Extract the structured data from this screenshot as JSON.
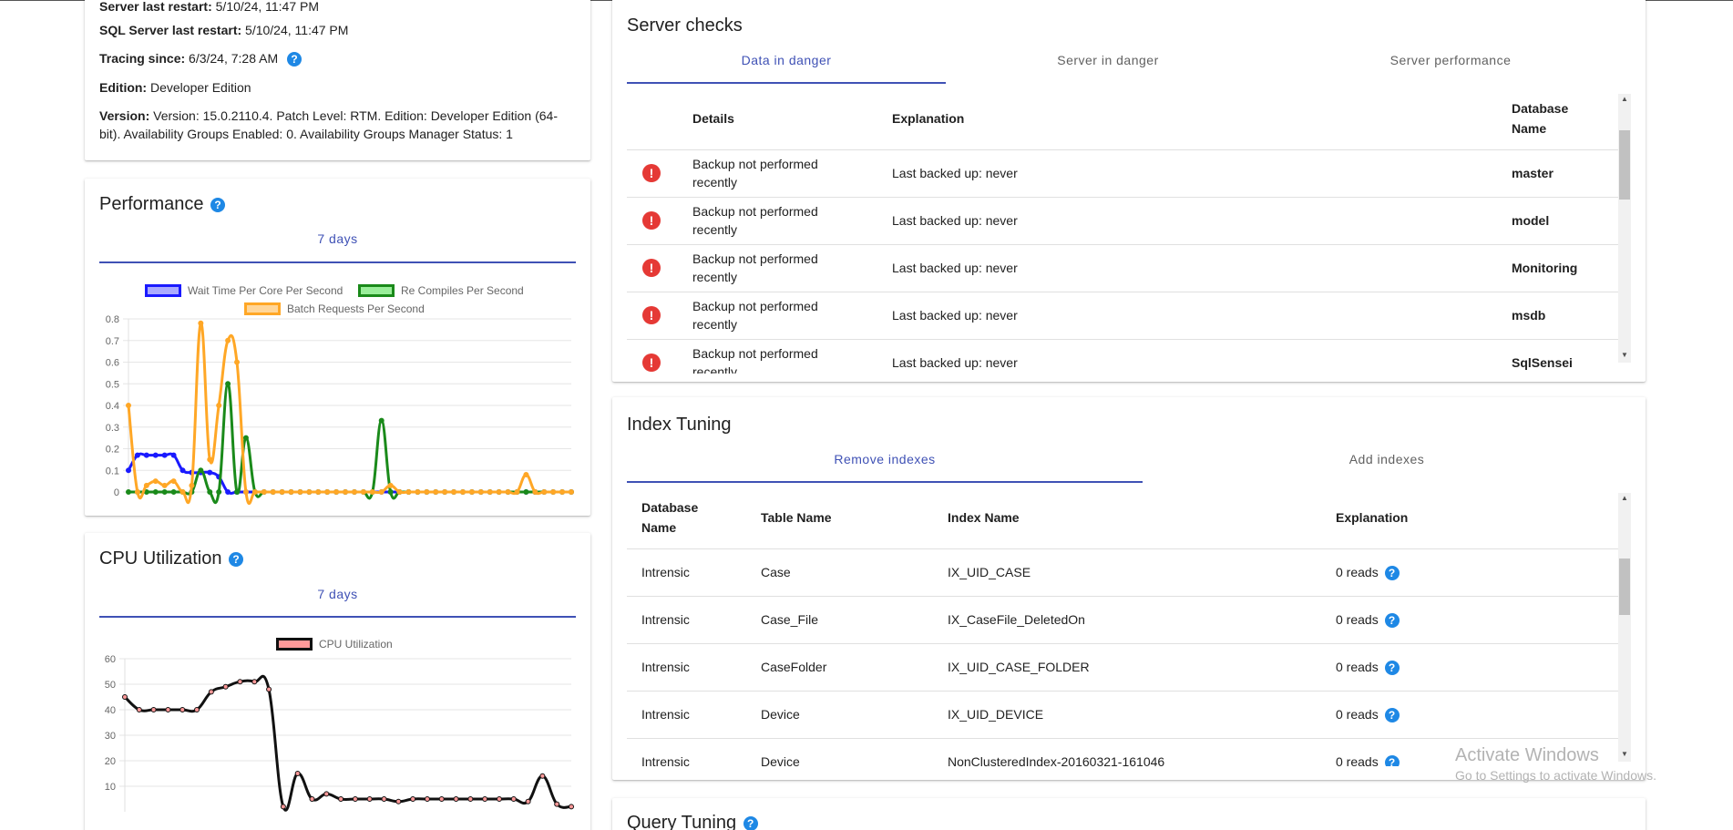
{
  "server_info": {
    "server_restart_label": "Server last restart:",
    "server_restart_value": "5/10/24, 11:47 PM",
    "sql_restart_label": "SQL Server last restart:",
    "sql_restart_value": "5/10/24, 11:47 PM",
    "tracing_label": "Tracing since:",
    "tracing_value": "6/3/24, 7:28 AM",
    "edition_label": "Edition:",
    "edition_value": "Developer Edition",
    "version_label": "Version:",
    "version_value_line1": "Version: 15.0.2110.4. Patch Level: RTM. Edition: Developer Edition (64-",
    "version_value_line2": "bit). Availability Groups Enabled: 0. Availability Groups Manager Status: 1"
  },
  "performance": {
    "title": "Performance",
    "tab": "7 days"
  },
  "cpu": {
    "title": "CPU Utilization",
    "tab": "7 days"
  },
  "server_checks": {
    "title": "Server checks",
    "tabs": [
      "Data in danger",
      "Server in danger",
      "Server performance"
    ],
    "headers": [
      "Details",
      "Explanation",
      "Database",
      "Name"
    ],
    "rows": [
      {
        "details1": "Backup not performed",
        "details2": "recently",
        "explanation": "Last backed up: never",
        "database": "master"
      },
      {
        "details1": "Backup not performed",
        "details2": "recently",
        "explanation": "Last backed up: never",
        "database": "model"
      },
      {
        "details1": "Backup not performed",
        "details2": "recently",
        "explanation": "Last backed up: never",
        "database": "Monitoring"
      },
      {
        "details1": "Backup not performed",
        "details2": "recently",
        "explanation": "Last backed up: never",
        "database": "msdb"
      },
      {
        "details1": "Backup not performed",
        "details2": "recently",
        "explanation": "Last backed up: never",
        "database": "SqlSensei"
      }
    ]
  },
  "index_tuning": {
    "title": "Index Tuning",
    "tabs": [
      "Remove indexes",
      "Add indexes"
    ],
    "headers": [
      "Database",
      "Name",
      "Table Name",
      "Index Name",
      "Explanation"
    ],
    "rows": [
      {
        "database": "Intrensic",
        "table": "Case",
        "index": "IX_UID_CASE",
        "explanation": "0 reads"
      },
      {
        "database": "Intrensic",
        "table": "Case_File",
        "index": "IX_CaseFile_DeletedOn",
        "explanation": "0 reads"
      },
      {
        "database": "Intrensic",
        "table": "CaseFolder",
        "index": "IX_UID_CASE_FOLDER",
        "explanation": "0 reads"
      },
      {
        "database": "Intrensic",
        "table": "Device",
        "index": "IX_UID_DEVICE",
        "explanation": "0 reads"
      },
      {
        "database": "Intrensic",
        "table": "Device",
        "index": "NonClusteredIndex-20160321-161046",
        "explanation": "0 reads"
      }
    ]
  },
  "query_tuning": {
    "title": "Query Tuning"
  },
  "watermark": {
    "line1": "Activate Windows",
    "line2": "Go to Settings to activate Windows."
  },
  "chart_data": [
    {
      "type": "line",
      "title": "",
      "legend": [
        "Wait Time Per Core Per Second",
        "Re Compiles Per Second",
        "Batch Requests Per Second"
      ],
      "yticks": [
        "0.8",
        "0.7",
        "0.6",
        "0.5",
        "0.4",
        "0.3",
        "0.2",
        "0.1",
        "0"
      ],
      "ylim": [
        0,
        0.8
      ],
      "grid": true,
      "colors": [
        "#1a1aff",
        "#1a8a1a",
        "#ffa726"
      ],
      "series": [
        {
          "name": "Wait Time Per Core Per Second",
          "values": [
            0.1,
            0.17,
            0.17,
            0.17,
            0.17,
            0.17,
            0.1,
            0.09,
            0.09,
            0.09,
            0.07,
            0,
            0,
            0,
            0,
            0,
            0,
            0,
            0,
            0,
            0,
            0,
            0,
            0,
            0,
            0,
            0,
            0,
            0,
            0,
            0,
            0,
            0,
            0,
            0,
            0,
            0,
            0,
            0,
            0,
            0,
            0,
            0,
            0,
            0,
            0,
            0,
            0,
            0,
            0
          ]
        },
        {
          "name": "Re Compiles Per Second",
          "values": [
            0,
            0,
            0,
            0,
            0,
            0,
            0,
            0,
            0.1,
            0,
            0,
            0.5,
            0,
            0.25,
            0,
            0,
            0,
            0,
            0,
            0,
            0,
            0,
            0,
            0,
            0,
            0,
            0,
            0,
            0.33,
            0,
            0,
            0,
            0,
            0,
            0,
            0,
            0,
            0,
            0,
            0,
            0,
            0,
            0,
            0,
            0,
            0,
            0,
            0,
            0,
            0
          ]
        },
        {
          "name": "Batch Requests Per Second",
          "values": [
            0.4,
            0,
            0.03,
            0.05,
            0.03,
            0.05,
            0,
            0.03,
            0.78,
            0.15,
            0.4,
            0.7,
            0.6,
            0,
            0,
            0,
            0,
            0,
            0,
            0,
            0,
            0,
            0,
            0,
            0,
            0,
            0,
            0,
            0,
            0.03,
            0,
            0,
            0,
            0,
            0,
            0,
            0,
            0,
            0,
            0,
            0,
            0,
            0,
            0,
            0.08,
            0,
            0,
            0,
            0,
            0
          ]
        }
      ]
    },
    {
      "type": "line",
      "title": "",
      "legend": [
        "CPU Utilization"
      ],
      "yticks": [
        "60",
        "50",
        "40",
        "30",
        "20",
        "10"
      ],
      "ylim": [
        0,
        60
      ],
      "grid": true,
      "colors": [
        "#111111"
      ],
      "series": [
        {
          "name": "CPU Utilization",
          "values": [
            45,
            40,
            40,
            40,
            40,
            40,
            47,
            49,
            51,
            51,
            48,
            2,
            15,
            5,
            7,
            5,
            5,
            5,
            5,
            4,
            5,
            5,
            5,
            5,
            5,
            5,
            5,
            5,
            4,
            14,
            3,
            2
          ]
        }
      ]
    }
  ]
}
